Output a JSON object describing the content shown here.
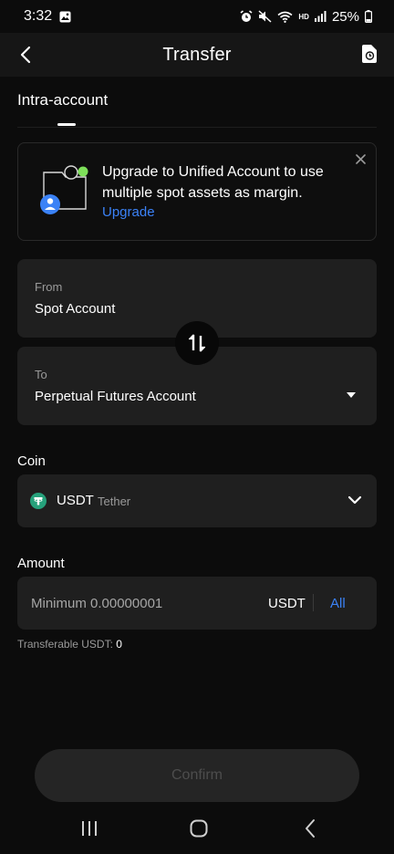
{
  "status_bar": {
    "time": "3:32",
    "battery": "25%",
    "network_badge": "HD"
  },
  "header": {
    "title": "Transfer"
  },
  "tabs": [
    {
      "label": "Intra-account",
      "active": true
    }
  ],
  "banner": {
    "text": "Upgrade to Unified Account to use multiple spot assets as margin.",
    "link": "Upgrade"
  },
  "transfer": {
    "from_caption": "From",
    "from_value": "Spot Account",
    "to_caption": "To",
    "to_value": "Perpetual Futures Account"
  },
  "coin": {
    "label": "Coin",
    "symbol": "USDT",
    "name": "Tether"
  },
  "amount": {
    "label": "Amount",
    "placeholder": "Minimum 0.00000001",
    "unit": "USDT",
    "all_label": "All",
    "transferable_label": "Transferable USDT:",
    "transferable_value": "0"
  },
  "confirm_label": "Confirm",
  "colors": {
    "accent_blue": "#3b82f6",
    "tether_green": "#26a17b",
    "card_bg": "#1f1f1f"
  },
  "icons": [
    "image-icon",
    "alarm-icon",
    "mute-icon",
    "wifi-icon",
    "signal-icon",
    "battery-icon",
    "back-arrow-icon",
    "history-icon",
    "account-illustration-icon",
    "close-icon",
    "swap-icon",
    "caret-down-icon",
    "tether-icon",
    "chevron-down-icon",
    "recent-apps-icon",
    "home-icon",
    "nav-back-icon"
  ]
}
